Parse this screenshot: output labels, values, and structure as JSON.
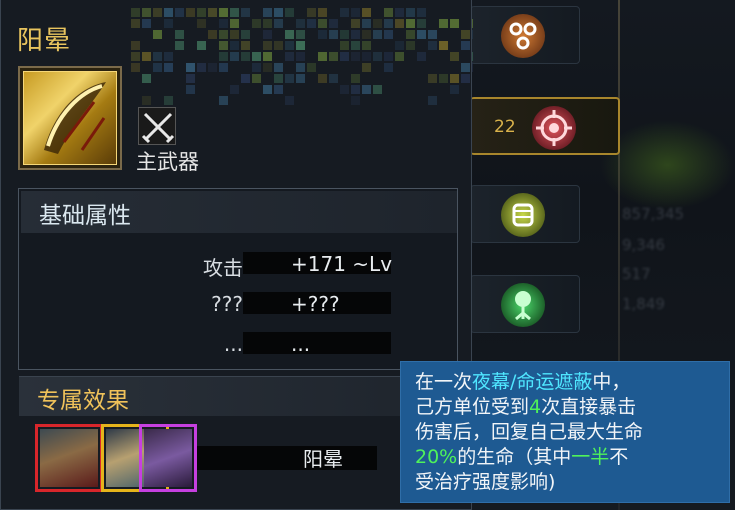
{
  "item": {
    "name": "阳晕",
    "type_label": "主武器",
    "type_icon": "crossed-swords-icon"
  },
  "base_attributes": {
    "title": "基础属性",
    "rows": [
      {
        "name": "攻击",
        "value": "+171 ~Lv"
      },
      {
        "name": "???",
        "value": "+???"
      },
      {
        "name": "...",
        "value": "..."
      }
    ]
  },
  "exclusive_effect": {
    "title": "专属效果",
    "effect_name": "阳晕",
    "heroes": [
      {
        "icon": "hero-portrait-red-icon",
        "frame_color": "#d8262b"
      },
      {
        "icon": "hero-portrait-gold-icon",
        "frame_color": "#e5b41b"
      },
      {
        "icon": "hero-portrait-purple-icon",
        "frame_color": "#c640e0"
      }
    ]
  },
  "tooltip": {
    "seg1": "在一次",
    "seg2": "夜幕/命运遮蔽",
    "seg3": "中，",
    "seg4": "己方单位受到",
    "seg5": "4",
    "seg6": "次直接暴击",
    "seg7": "伤害后，回复自己最大生命",
    "seg8": "20%",
    "seg9": "的生命（其中",
    "seg10": "一半",
    "seg11": "不",
    "seg12": "受治疗强度影响)"
  },
  "side_tabs": [
    {
      "icon": "link-chain-icon",
      "count": ""
    },
    {
      "icon": "target-icon",
      "count": "22"
    },
    {
      "icon": "fist-gauntlet-icon",
      "count": ""
    },
    {
      "icon": "tree-of-life-icon",
      "count": ""
    }
  ],
  "background_numbers": [
    "857,345",
    "9,346",
    "517",
    "1,849"
  ],
  "colors": {
    "title_gold": "#e8c45e",
    "tooltip_bg": "#1e5a92",
    "highlight_cyan": "#4fe6ff",
    "highlight_green": "#4ff25a"
  }
}
